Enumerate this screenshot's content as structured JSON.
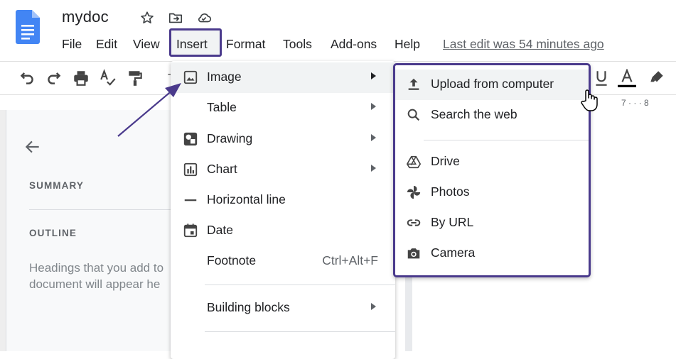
{
  "doc": {
    "title": "mydoc"
  },
  "menubar": {
    "items": [
      "File",
      "Edit",
      "View",
      "Insert",
      "Format",
      "Tools",
      "Add-ons",
      "Help"
    ],
    "last_edit": "Last edit was 54 minutes ago",
    "active": "Insert"
  },
  "side_panel": {
    "summary_label": "SUMMARY",
    "outline_label": "OUTLINE",
    "outline_hint_1": "Headings that you add to",
    "outline_hint_2": "document will appear he"
  },
  "ruler": {
    "marks": "7 · · · 8"
  },
  "insert_menu": {
    "items": [
      {
        "label": "Image",
        "icon": "image-icon",
        "submenu": true,
        "highlighted": true
      },
      {
        "label": "Table",
        "icon": "",
        "submenu": true
      },
      {
        "label": "Drawing",
        "icon": "drawing-icon",
        "submenu": true
      },
      {
        "label": "Chart",
        "icon": "chart-icon",
        "submenu": true
      },
      {
        "label": "Horizontal line",
        "icon": "horizontal-line-icon",
        "submenu": false
      },
      {
        "label": "Date",
        "icon": "calendar-icon",
        "submenu": false
      },
      {
        "label": "Footnote",
        "icon": "",
        "submenu": false,
        "shortcut": "Ctrl+Alt+F"
      },
      {
        "label": "Building blocks",
        "icon": "",
        "submenu": true
      }
    ]
  },
  "image_submenu": {
    "items": [
      {
        "label": "Upload from computer",
        "icon": "upload-icon",
        "highlighted": true
      },
      {
        "label": "Search the web",
        "icon": "search-icon"
      },
      {
        "label": "Drive",
        "icon": "drive-icon"
      },
      {
        "label": "Photos",
        "icon": "photos-icon"
      },
      {
        "label": "By URL",
        "icon": "link-icon"
      },
      {
        "label": "Camera",
        "icon": "camera-icon"
      }
    ]
  },
  "colors": {
    "highlight_border": "#4a3a8c",
    "hover_bg": "#f1f3f4",
    "doc_blue": "#4285f4"
  }
}
